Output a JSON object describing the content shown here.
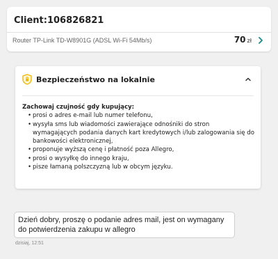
{
  "header": {
    "client_title": "Client:106826821",
    "product": {
      "name": "Router TP-Link TD-W8901G (ADSL Wi-Fi 54Mb/s)",
      "price": "70",
      "currency": "zł"
    }
  },
  "safety": {
    "title": "Bezpieczeństwo na lokalnie",
    "warning_heading": "Zachowaj czujność gdy kupujący:",
    "tips": [
      "prosi o adres e-mail lub numer telefonu,",
      "wysyła sms lub wiadomości zawierające odnośniki do stron wymagających podania danych kart kredytowych i/lub zalogowania się do bankowości elektronicznej,",
      "proponuje wyższą cenę i płatność poza Allegro,",
      "prosi o wysyłkę do innego kraju,",
      "pisze łamaną polszczyzną lub w obcym języku."
    ]
  },
  "chat": {
    "message_text": "Dzień dobry, proszę o podanie adres mail, jest on wymagany do potwierdzenia zakupu w allegro",
    "message_time": "dzisiaj, 12:51"
  },
  "icons": {
    "shield": "shield-icon",
    "expand": "chevron-right-icon",
    "collapse": "chevron-up-icon"
  },
  "colors": {
    "background": "#f0f0f0",
    "chevron_accent": "#1a8a8a",
    "shield_accent": "#f2b705"
  }
}
